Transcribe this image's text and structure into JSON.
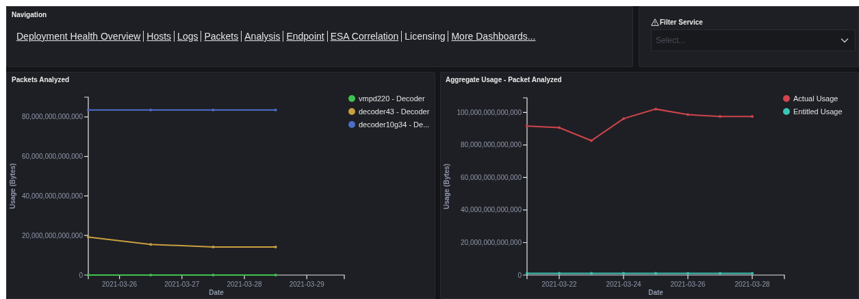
{
  "navigation": {
    "title": "Navigation",
    "links": [
      {
        "label": "Deployment Health Overview",
        "kind": "link"
      },
      {
        "label": "Hosts",
        "kind": "link"
      },
      {
        "label": "Logs",
        "kind": "link"
      },
      {
        "label": "Packets",
        "kind": "link"
      },
      {
        "label": "Analysis",
        "kind": "link"
      },
      {
        "label": "Endpoint",
        "kind": "link"
      },
      {
        "label": "ESA Correlation",
        "kind": "link"
      },
      {
        "label": "Licensing",
        "kind": "current"
      },
      {
        "label": "More Dashboards...",
        "kind": "link"
      }
    ]
  },
  "filter": {
    "title": "Filter Service",
    "placeholder": "Select..."
  },
  "charts": [
    {
      "title": "Packets Analyzed",
      "chart_data": {
        "type": "line",
        "xlabel": "Date",
        "ylabel": "Usage (Bytes)",
        "legend": "right",
        "categories": [
          null,
          "2021-03-26",
          null,
          "2021-03-27",
          null,
          "2021-03-28",
          null,
          "2021-03-29"
        ],
        "ylim": [
          0,
          90000000000000
        ],
        "yticks": [
          {
            "value": 0,
            "label": "0"
          },
          {
            "value": 20000000000000,
            "label": "20,000,000,000,000"
          },
          {
            "value": 40000000000000,
            "label": "40,000,000,000,000"
          },
          {
            "value": 60000000000000,
            "label": "60,000,000,000,000"
          },
          {
            "value": 80000000000000,
            "label": "80,000,000,000,000"
          }
        ],
        "series": [
          {
            "name": "vmpd220 - Decoder",
            "color": "#3fc24e",
            "values": [
              0,
              null,
              0,
              null,
              0,
              null,
              0,
              null
            ]
          },
          {
            "name": "decoder43 - Decoder",
            "color": "#c9a03f",
            "values": [
              19200000000000,
              null,
              15500000000000,
              null,
              14200000000000,
              null,
              14200000000000,
              null
            ]
          },
          {
            "name": "decoder10g34 - De...",
            "color": "#4b6fc8",
            "values": [
              83500000000000,
              null,
              83500000000000,
              null,
              83500000000000,
              null,
              83500000000000,
              null
            ]
          }
        ]
      }
    },
    {
      "title": "Aggregate Usage - Packet Analyzed",
      "chart_data": {
        "type": "line",
        "xlabel": "Date",
        "ylabel": "Usage (Bytes)",
        "legend": "right",
        "categories": [
          null,
          "2021-03-22",
          null,
          "2021-03-24",
          null,
          "2021-03-26",
          null,
          "2021-03-28"
        ],
        "ylim": [
          0,
          109000000000000
        ],
        "yticks": [
          {
            "value": 0,
            "label": "0"
          },
          {
            "value": 20000000000000,
            "label": "20,000,000,000,000"
          },
          {
            "value": 40000000000000,
            "label": "40,000,000,000,000"
          },
          {
            "value": 60000000000000,
            "label": "60,000,000,000,000"
          },
          {
            "value": 80000000000000,
            "label": "80,000,000,000,000"
          },
          {
            "value": 100000000000000,
            "label": "100,000,000,000,000"
          }
        ],
        "series": [
          {
            "name": "Actual Usage",
            "color": "#d0454c",
            "values": [
              91600000000000,
              90700000000000,
              82700000000000,
              96200000000000,
              102100000000000,
              98700000000000,
              97500000000000,
              97500000000000
            ]
          },
          {
            "name": "Entitled Usage",
            "color": "#3cc4b4",
            "values": [
              1000000000000,
              1000000000000,
              1000000000000,
              1000000000000,
              1000000000000,
              1000000000000,
              1000000000000,
              1000000000000
            ]
          }
        ]
      }
    }
  ]
}
